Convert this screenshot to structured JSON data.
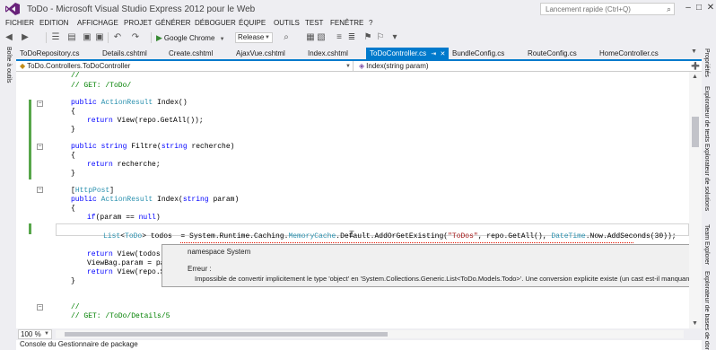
{
  "window": {
    "title": "ToDo - Microsoft Visual Studio Express 2012 pour le Web",
    "quick_launch_placeholder": "Lancement rapide (Ctrl+Q)"
  },
  "menu": [
    "FICHIER",
    "EDITION",
    "AFFICHAGE",
    "PROJET",
    "GÉNÉRER",
    "DÉBOGUER",
    "ÉQUIPE",
    "OUTILS",
    "TEST",
    "FENÊTRE",
    "?"
  ],
  "toolbar": {
    "run_label": "Google Chrome",
    "configuration": "Release"
  },
  "left_panel": {
    "tab": "Boîte à outils"
  },
  "right_panel": {
    "tabs": [
      "Propriétés",
      "Explorateur de tests",
      "Explorateur de solutions",
      "Team Explorer",
      "Explorateur de bases de données"
    ]
  },
  "doc_tabs": [
    {
      "label": "ToDoRepository.cs"
    },
    {
      "label": "Details.cshtml"
    },
    {
      "label": "Create.cshtml"
    },
    {
      "label": "AjaxVue.cshtml"
    },
    {
      "label": "Index.cshtml"
    },
    {
      "label": "ToDoController.cs",
      "active": true
    },
    {
      "label": "BundleConfig.cs"
    },
    {
      "label": "RouteConfig.cs"
    },
    {
      "label": "HomeController.cs"
    }
  ],
  "nav_bar": {
    "class_scope": "ToDo.Controllers.ToDoController",
    "member": "Index(string param)"
  },
  "code": {
    "l1": "//",
    "l2": "// GET: /ToDo/",
    "l3_kw1": "public ",
    "l3_type": "ActionResult",
    "l3_rest": " Index()",
    "l4": "{",
    "l5_kw": "return ",
    "l5_rest": "View(repo.GetAll());",
    "l6": "}",
    "l7_kw": "public string ",
    "l7_rest": "Filtre(",
    "l7_kw2": "string",
    "l7_end": " recherche)",
    "l8": "{",
    "l9_kw": "return ",
    "l9_rest": "recherche;",
    "l10": "}",
    "l11_attr": "HttpPost",
    "l12_kw1": "public ",
    "l12_type": "ActionResult",
    "l12_mid": " Index(",
    "l12_kw2": "string",
    "l12_end": " param)",
    "l13": "{",
    "l14_kw": "if",
    "l14_mid": "(param == ",
    "l14_kw2": "null",
    "l14_end": ")",
    "l15_type1": "List",
    "l15_a": "<",
    "l15_type2": "ToDo",
    "l15_b": "> todos  = System.Runtime.Caching.",
    "l15_type3": "MemoryCache",
    "l15_c": ".Default.AddOrGetExisting(",
    "l15_str": "\"ToDos\"",
    "l15_d": ", repo.GetAll(), ",
    "l15_type4": "DateTime",
    "l15_e": ".Now.AddSeconds(30));",
    "l16_kw": "return ",
    "l16_rest": "View(todos);",
    "l17": "ViewBag.param = param;",
    "l18_kw": "return ",
    "l18_rest": "View(repo.Search(",
    "l19": "}",
    "l20": "//",
    "l21": "// GET: /ToDo/Details/5"
  },
  "tooltip": {
    "namespace": "namespace System",
    "error_label": "Erreur :",
    "message": "Impossible de convertir implicitement le type 'object' en 'System.Collections.Generic.List<ToDo.Models.Todo>'. Une conversion explicite existe (un cast est-il manquant ?)"
  },
  "zoom": "100 %",
  "bottom_panel": {
    "tab": "Console du Gestionnaire de package"
  },
  "colors": {
    "accent": "#007acc",
    "keyword": "#0000ff",
    "type": "#2b91af",
    "comment": "#008000",
    "string": "#a31515",
    "change_bar": "#57a64a",
    "error": "#e51400"
  }
}
